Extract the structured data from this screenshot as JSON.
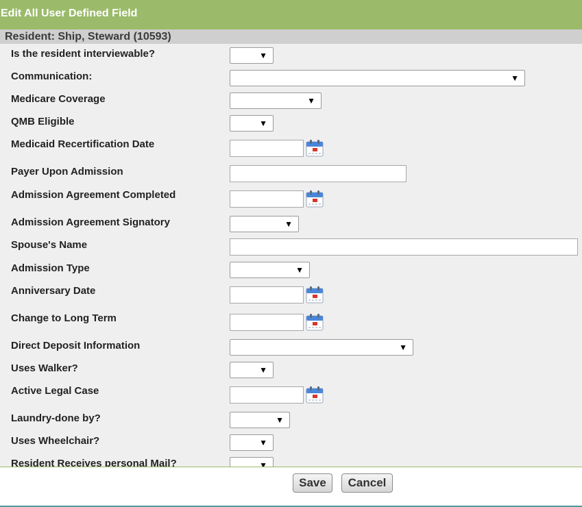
{
  "header": {
    "title": "Edit All User Defined Field"
  },
  "resident": {
    "label": "Resident: Ship, Steward (10593)"
  },
  "fields": [
    {
      "label": "Is the resident interviewable?",
      "control": "select",
      "value": ""
    },
    {
      "label": "Communication:",
      "control": "select",
      "value": ""
    },
    {
      "label": "Medicare Coverage",
      "control": "select",
      "value": ""
    },
    {
      "label": "QMB Eligible",
      "control": "select",
      "value": ""
    },
    {
      "label": "Medicaid Recertification Date",
      "control": "date",
      "value": "",
      "icon": "calendar-icon"
    },
    {
      "label": "Payer Upon Admission",
      "control": "text",
      "value": ""
    },
    {
      "label": "Admission Agreement Completed",
      "control": "date",
      "value": "",
      "icon": "calendar-icon"
    },
    {
      "label": "Admission Agreement Signatory",
      "control": "select",
      "value": ""
    },
    {
      "label": "Spouse's Name",
      "control": "text",
      "value": ""
    },
    {
      "label": "Admission Type",
      "control": "select",
      "value": ""
    },
    {
      "label": "Anniversary Date",
      "control": "date",
      "value": "",
      "icon": "calendar-icon"
    },
    {
      "label": "Change to Long Term",
      "control": "date",
      "value": "",
      "icon": "calendar-icon"
    },
    {
      "label": "Direct Deposit Information",
      "control": "select",
      "value": ""
    },
    {
      "label": "Uses Walker?",
      "control": "select",
      "value": ""
    },
    {
      "label": "Active Legal Case",
      "control": "date",
      "value": "",
      "icon": "calendar-icon"
    },
    {
      "label": "Laundry-done by?",
      "control": "select",
      "value": ""
    },
    {
      "label": "Uses Wheelchair?",
      "control": "select",
      "value": ""
    },
    {
      "label": "Resident Receives personal Mail?",
      "control": "select",
      "value": ""
    }
  ],
  "dropdown_arrow": "▼",
  "actions": {
    "save_label": "Save",
    "cancel_label": "Cancel"
  },
  "colors": {
    "header_bg": "#9bbb6a",
    "resident_bg": "#cfcfcf",
    "form_bg": "#efefef"
  }
}
